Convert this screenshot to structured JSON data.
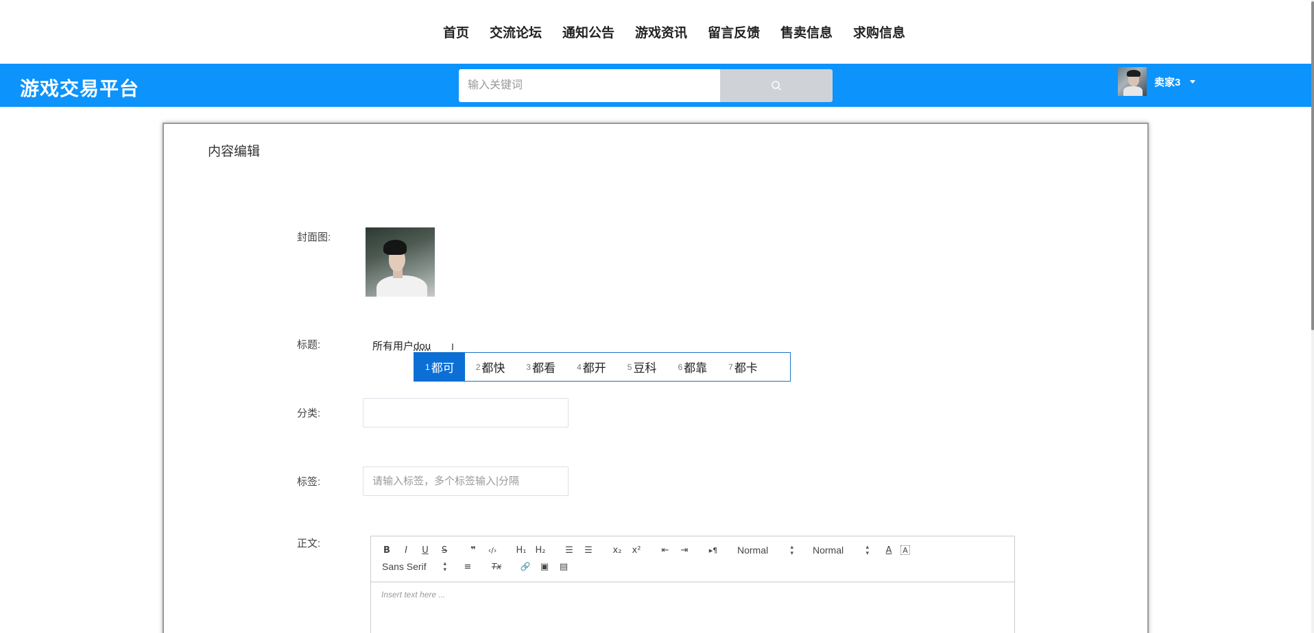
{
  "nav": {
    "items": [
      "首页",
      "交流论坛",
      "通知公告",
      "游戏资讯",
      "留言反馈",
      "售卖信息",
      "求购信息"
    ]
  },
  "header": {
    "logo": "游戏交易平台",
    "search_placeholder": "输入关键词",
    "search_icon": "search-icon",
    "username": "卖家3",
    "brand_color": "#0d93fc"
  },
  "card": {
    "title": "内容编辑"
  },
  "form": {
    "cover_label": "封面图:",
    "title_label": "标题:",
    "title_value_text": "所有用户",
    "title_value_pinyin": "dou",
    "category_label": "分类:",
    "category_value": "",
    "tags_label": "标签:",
    "tags_placeholder": "请输入标签，多个标签输入|分隔",
    "body_label": "正文:"
  },
  "ime": {
    "candidates": [
      {
        "num": "1",
        "text": "都可",
        "selected": true
      },
      {
        "num": "2",
        "text": "都快"
      },
      {
        "num": "3",
        "text": "都看"
      },
      {
        "num": "4",
        "text": "都开"
      },
      {
        "num": "5",
        "text": "豆科"
      },
      {
        "num": "6",
        "text": "都靠"
      },
      {
        "num": "7",
        "text": "都卡"
      }
    ]
  },
  "editor": {
    "toolbar": {
      "bold": "B",
      "italic": "I",
      "underline": "U",
      "strike": "S",
      "blockquote": "❞",
      "code": "‹/›",
      "h1": "H₁",
      "h2": "H₂",
      "ordered_list": "☰",
      "bullet_list": "☰",
      "subscript": "x₂",
      "superscript": "x²",
      "outdent": "⇤",
      "indent": "⇥",
      "direction": "▸¶",
      "size_select": "Normal",
      "header_select": "Normal",
      "font_color": "A",
      "background": "A",
      "font_select": "Sans Serif",
      "align": "≡",
      "clean": "Tx",
      "link": "🔗",
      "image": "▣",
      "video": "▤"
    },
    "placeholder": "Insert text here ..."
  }
}
